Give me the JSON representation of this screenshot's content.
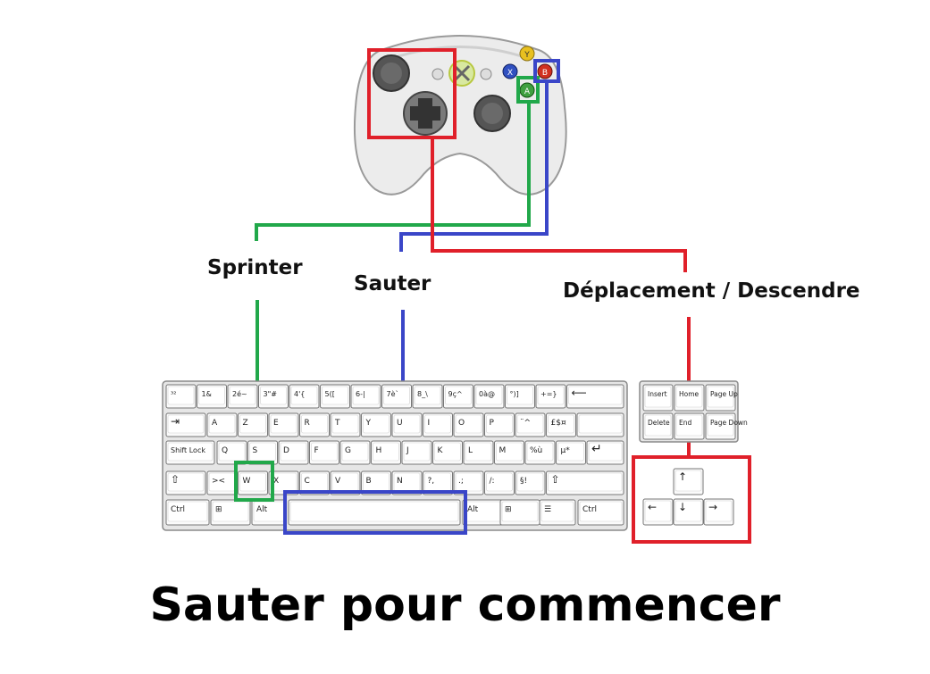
{
  "labels": {
    "sprint": "Sprinter",
    "jump": "Sauter",
    "move": "Déplacement / Descendre"
  },
  "prompt": "Sauter pour commencer",
  "colors": {
    "sprint": "#21a84a",
    "jump": "#3a46c8",
    "move": "#e0202a"
  },
  "controller": {
    "buttons": [
      "Y",
      "X",
      "B",
      "A"
    ],
    "small": [
      "Back",
      "Start"
    ]
  },
  "keyboard": {
    "row1": [
      "³²",
      "1&",
      "2é~",
      "3\"#",
      "4'{",
      "5([",
      "6-|",
      "7è`",
      "8_\\",
      "9ç^",
      "0à@",
      "°)]",
      "+=}"
    ],
    "row2": [
      "A",
      "Z",
      "E",
      "R",
      "T",
      "Y",
      "U",
      "I",
      "O",
      "P",
      "¨^",
      "£$¤"
    ],
    "row2_prefix": "⇥",
    "row3_prefix": "Shift Lock",
    "row3": [
      "Q",
      "S",
      "D",
      "F",
      "G",
      "H",
      "J",
      "K",
      "L",
      "M",
      "%ù",
      "µ*"
    ],
    "row4": [
      "><",
      "W",
      "X",
      "C",
      "V",
      "B",
      "N",
      "?,",
      ".;",
      "/:",
      "§!"
    ],
    "row5": [
      "Ctrl",
      "⊞",
      "Alt",
      "",
      "Alt",
      "⊞",
      "☰",
      "Ctrl"
    ],
    "nav": [
      "Insert",
      "Home",
      "Page Up",
      "Delete",
      "End",
      "Page Down"
    ],
    "arrows": [
      "↑",
      "←",
      "↓",
      "→"
    ]
  }
}
